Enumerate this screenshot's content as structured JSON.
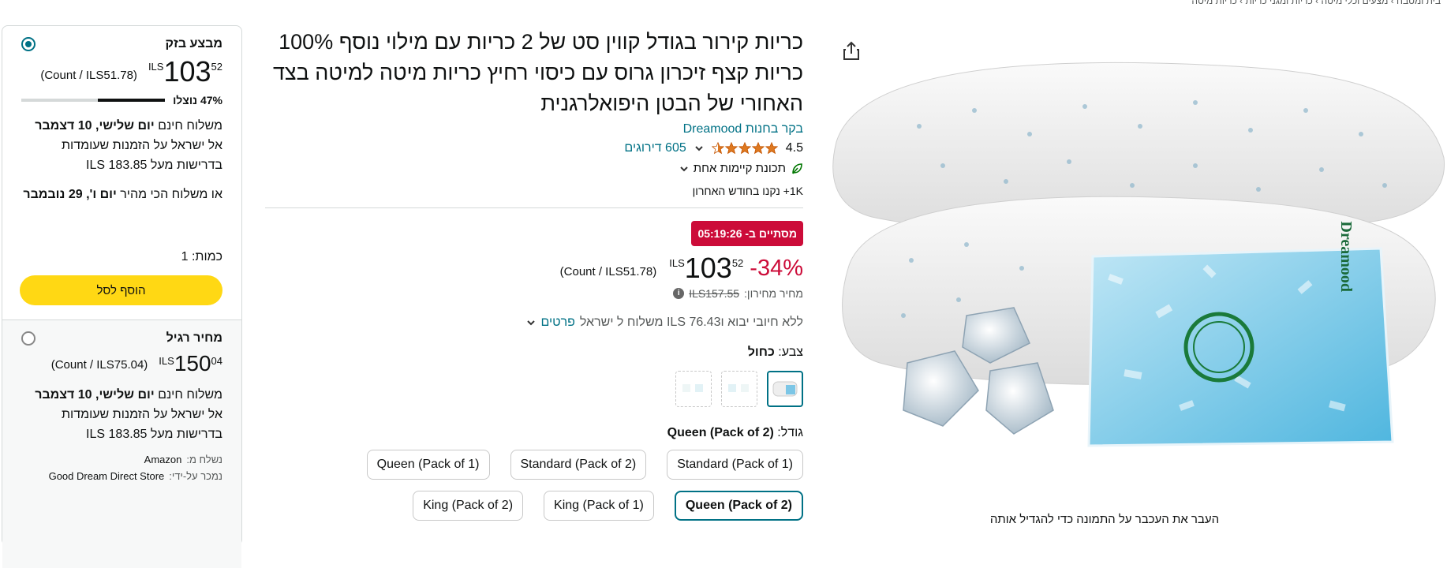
{
  "breadcrumb": "בית ומטבח › מצעים וכלי מיטה › כריות ומגני כריות › כריות מיטה",
  "image_area": {
    "hover_hint": "העבר את העכבר על התמונה כדי להגדיל אותה",
    "share_icon": "share-icon",
    "brand_on_bag": "Dreamood"
  },
  "product": {
    "title": "כריות קירור בגודל קווין סט של 2 כריות עם מילוי נוסף 100% כריות קצף זיכרון גרוס עם כיסוי רחיץ כריות מיטה למיטה בצד האחורי של הבטן היפואלרגנית",
    "store_link": "בקר בחנות Dreamood",
    "rating_value": "4.5",
    "rating_stars": 4.5,
    "ratings_count": "605 דירוגים",
    "climate_feature": "תכונת קיימות אחת",
    "bought_recently": "1K+ נקנו בחודש האחרון",
    "deal_badge": "מסתיים ב- 05:19:26",
    "discount": "-34%",
    "price_currency": "ILS",
    "price_whole": "103",
    "price_fraction": "52",
    "unit_price": "(Count / ILS51.78)",
    "list_price_label": "מחיר מחירון:",
    "list_price": "ILS157.55",
    "shipping_text": "ללא חיובי יבוא ו76.43 ILS משלוח ל ישראל",
    "shipping_details_link": "פרטים",
    "color_label": "צבע:",
    "color_value": "כחול",
    "size_label": "גודל:",
    "size_value": "Queen (Pack of 2)",
    "sizes": [
      "Standard (Pack of 1)",
      "Standard (Pack of 2)",
      "Queen (Pack of 1)",
      "Queen (Pack of 2)",
      "King (Pack of 1)",
      "King (Pack of 2)"
    ]
  },
  "buybox": {
    "deal_option": {
      "label": "מבצע בזק",
      "currency": "ILS",
      "price_whole": "103",
      "price_fraction": "52",
      "unit_price": "(Count / ILS51.78)",
      "claimed": "47% נוצלו",
      "claimed_fraction": 0.47,
      "delivery_line1_prefix": "משלוח חינם ",
      "delivery_line1_bold": "יום שלישי, 10 דצמבר",
      "delivery_line2": "אל ישראל על הזמנות שעומדות",
      "delivery_line3": "בדרישות מעל 183.85 ILS",
      "fastest_prefix": "או משלוח הכי מהיר ",
      "fastest_bold": "יום ו', 29 נובמבר",
      "quantity": "כמות: 1",
      "add_to_cart": "הוסף לסל"
    },
    "regular_option": {
      "label": "מחיר רגיל",
      "currency": "ILS",
      "price_whole": "150",
      "price_fraction": "04",
      "unit_price": "(Count / ILS75.04)",
      "delivery_line1_prefix": "משלוח חינם ",
      "delivery_line1_bold": "יום שלישי, 10 דצמבר",
      "delivery_line2": "אל ישראל על הזמנות שעומדות",
      "delivery_line3": "בדרישות מעל 183.85 ILS",
      "ships_from_label": "נשלח מ:",
      "ships_from": "Amazon",
      "sold_by_label": "נמכר על-ידי:",
      "sold_by": "Good Dream Direct Store"
    }
  },
  "colors": {
    "link": "#007185",
    "deal_red": "#cc0c39",
    "cart_yellow": "#ffd814"
  }
}
